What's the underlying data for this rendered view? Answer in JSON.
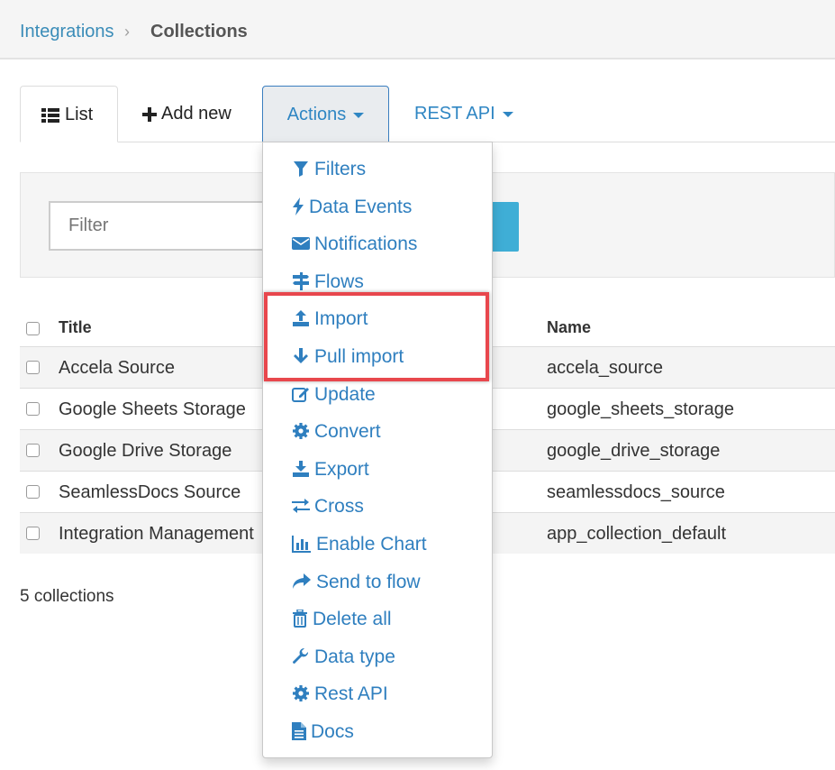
{
  "breadcrumb": {
    "parent": "Integrations",
    "separator": "›",
    "current": "Collections"
  },
  "tabs": {
    "list": "List",
    "add_new": "Add new",
    "actions": "Actions",
    "rest_api": "REST API"
  },
  "filter": {
    "placeholder": "Filter"
  },
  "table": {
    "headers": {
      "title": "Title",
      "name": "Name"
    },
    "rows": [
      {
        "title": "Accela Source",
        "name": "accela_source"
      },
      {
        "title": "Google Sheets Storage",
        "name": "google_sheets_storage"
      },
      {
        "title": "Google Drive Storage",
        "name": "google_drive_storage"
      },
      {
        "title": "SeamlessDocs Source",
        "name": "seamlessdocs_source"
      },
      {
        "title": "Integration Management",
        "name": "app_collection_default"
      }
    ]
  },
  "footer": {
    "count": "5 collections"
  },
  "actions_menu": {
    "items": [
      {
        "label": "Filters",
        "icon": "filter-icon"
      },
      {
        "label": "Data Events",
        "icon": "bolt-icon"
      },
      {
        "label": "Notifications",
        "icon": "envelope-icon"
      },
      {
        "label": "Flows",
        "icon": "signpost-icon"
      },
      {
        "label": "Import",
        "icon": "upload-icon"
      },
      {
        "label": "Pull import",
        "icon": "arrow-down-icon"
      },
      {
        "label": "Update",
        "icon": "edit-icon"
      },
      {
        "label": "Convert",
        "icon": "gear-icon"
      },
      {
        "label": "Export",
        "icon": "download-icon"
      },
      {
        "label": "Cross",
        "icon": "exchange-icon"
      },
      {
        "label": "Enable Chart",
        "icon": "bar-chart-icon"
      },
      {
        "label": "Send to flow",
        "icon": "share-icon"
      },
      {
        "label": "Delete all",
        "icon": "trash-icon"
      },
      {
        "label": "Data type",
        "icon": "wrench-icon"
      },
      {
        "label": "Rest API",
        "icon": "gear-icon"
      },
      {
        "label": "Docs",
        "icon": "file-icon"
      }
    ]
  },
  "colors": {
    "link": "#2f7fbf",
    "highlight_border": "#e8474d",
    "filter_button": "#3faed6"
  }
}
